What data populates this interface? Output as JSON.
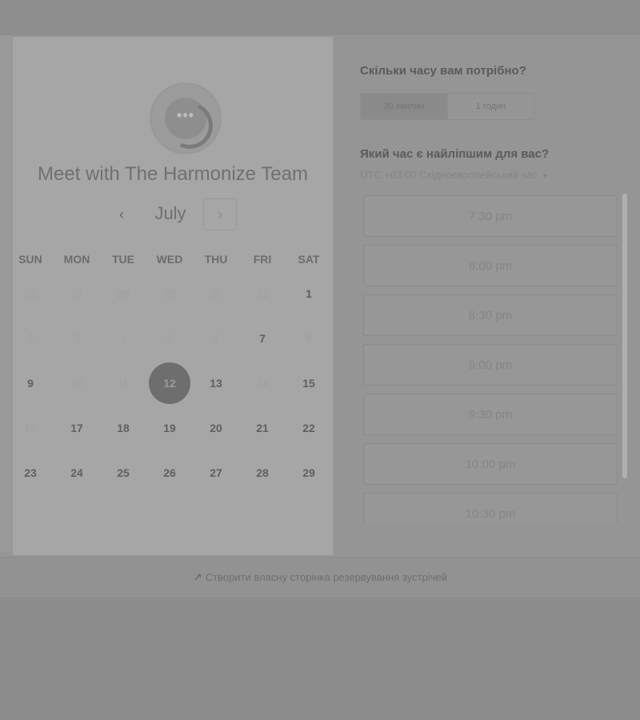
{
  "colors": {
    "selected_day": "#6e6e6e",
    "overlay": "#8c8c8c"
  },
  "scheduler": {
    "title": "Meet with The Harmonize Team",
    "avatar_icon": "chat-bubble-icon",
    "month": "July",
    "prev_icon": "chevron-left-icon",
    "next_icon": "chevron-right-icon",
    "prev_glyph": "‹",
    "next_glyph": "›",
    "weekdays": [
      "SUN",
      "MON",
      "TUE",
      "WED",
      "THU",
      "FRI",
      "SAT"
    ],
    "days": [
      {
        "label": "26",
        "state": "dim"
      },
      {
        "label": "27",
        "state": "dim"
      },
      {
        "label": "28",
        "state": "dim"
      },
      {
        "label": "29",
        "state": "dim"
      },
      {
        "label": "30",
        "state": "dim"
      },
      {
        "label": "31",
        "state": "dim"
      },
      {
        "label": "1",
        "state": "act"
      },
      {
        "label": "2",
        "state": "dim"
      },
      {
        "label": "3",
        "state": "dim"
      },
      {
        "label": "4",
        "state": "dim"
      },
      {
        "label": "5",
        "state": "dim"
      },
      {
        "label": "6",
        "state": "dim"
      },
      {
        "label": "7",
        "state": "act"
      },
      {
        "label": "8",
        "state": "dim"
      },
      {
        "label": "9",
        "state": "act"
      },
      {
        "label": "10",
        "state": "dim"
      },
      {
        "label": "11",
        "state": "dim"
      },
      {
        "label": "12",
        "state": "sel"
      },
      {
        "label": "13",
        "state": "act"
      },
      {
        "label": "14",
        "state": "dim"
      },
      {
        "label": "15",
        "state": "act"
      },
      {
        "label": "16",
        "state": "dim"
      },
      {
        "label": "17",
        "state": "act"
      },
      {
        "label": "18",
        "state": "act"
      },
      {
        "label": "19",
        "state": "act"
      },
      {
        "label": "20",
        "state": "act"
      },
      {
        "label": "21",
        "state": "act"
      },
      {
        "label": "22",
        "state": "act"
      },
      {
        "label": "23",
        "state": "act"
      },
      {
        "label": "24",
        "state": "act"
      },
      {
        "label": "25",
        "state": "act"
      },
      {
        "label": "26",
        "state": "act"
      },
      {
        "label": "27",
        "state": "act"
      },
      {
        "label": "28",
        "state": "act"
      },
      {
        "label": "29",
        "state": "act"
      }
    ]
  },
  "booking": {
    "duration_question": "Скільки часу вам потрібно?",
    "durations": [
      {
        "label": "30 хвилин",
        "active": true
      },
      {
        "label": "1 годин",
        "active": false
      }
    ],
    "time_question": "Який час є найліпшим для вас?",
    "timezone": "UTC +03:00 Східноєвропейський час",
    "timezone_caret": "▼",
    "slots": [
      "7:30 pm",
      "8:00 pm",
      "8:30 pm",
      "9:00 pm",
      "9:30 pm",
      "10:00 pm",
      "10:30 pm"
    ]
  },
  "footer": {
    "icon": "hubspot-sprocket-icon",
    "icon_glyph": "↗",
    "text": "Створити власну сторінка резервування зустрічей"
  }
}
